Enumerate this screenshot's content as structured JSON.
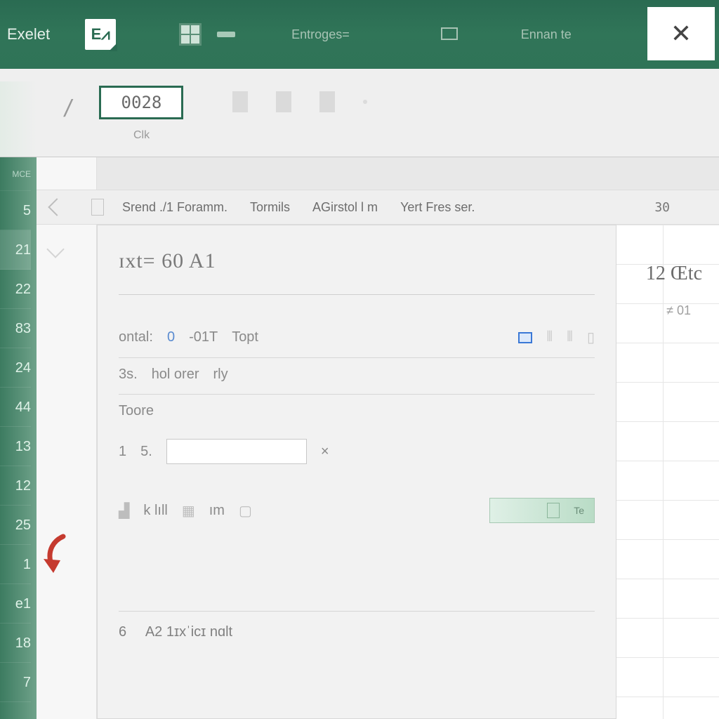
{
  "titlebar": {
    "app_name": "Exelet",
    "logo": "E⩘",
    "hint1": "Entroges=",
    "hint2": "Ennan te",
    "close": "✕"
  },
  "ribbon": {
    "name_box": "0028",
    "group_label": "Clk"
  },
  "tabs": {
    "items": [
      "Srend ./1 Foramm.",
      "Tormils",
      "AGirstol  l m",
      "Yert Fres  ser."
    ],
    "count": "30"
  },
  "side": {
    "label": "12  Œtc",
    "sub": "≠ 01"
  },
  "gutter": {
    "hdr": "MCE",
    "rows": [
      "5",
      "21",
      "22",
      "83",
      "24",
      "44",
      "13",
      "12",
      "25",
      "1",
      "e1",
      "18",
      "7"
    ]
  },
  "dialog": {
    "title": "ɪxt= 60 A1",
    "line1_label": "ontal:",
    "line1_a": "0",
    "line1_b": "-01T",
    "line1_c": "Topt",
    "line2_a": "3s.",
    "line2_b": "hol orer",
    "line2_c": "rly",
    "line3": "Toore",
    "line4_a": "1",
    "line4_b": "5.",
    "line4_mark": "×",
    "line5_a": "k  lıll",
    "line5_b": "ım",
    "btn": "Te",
    "footer_a": "6",
    "footer_b": "A2  1ɪxˈicɪ nɑlt"
  }
}
